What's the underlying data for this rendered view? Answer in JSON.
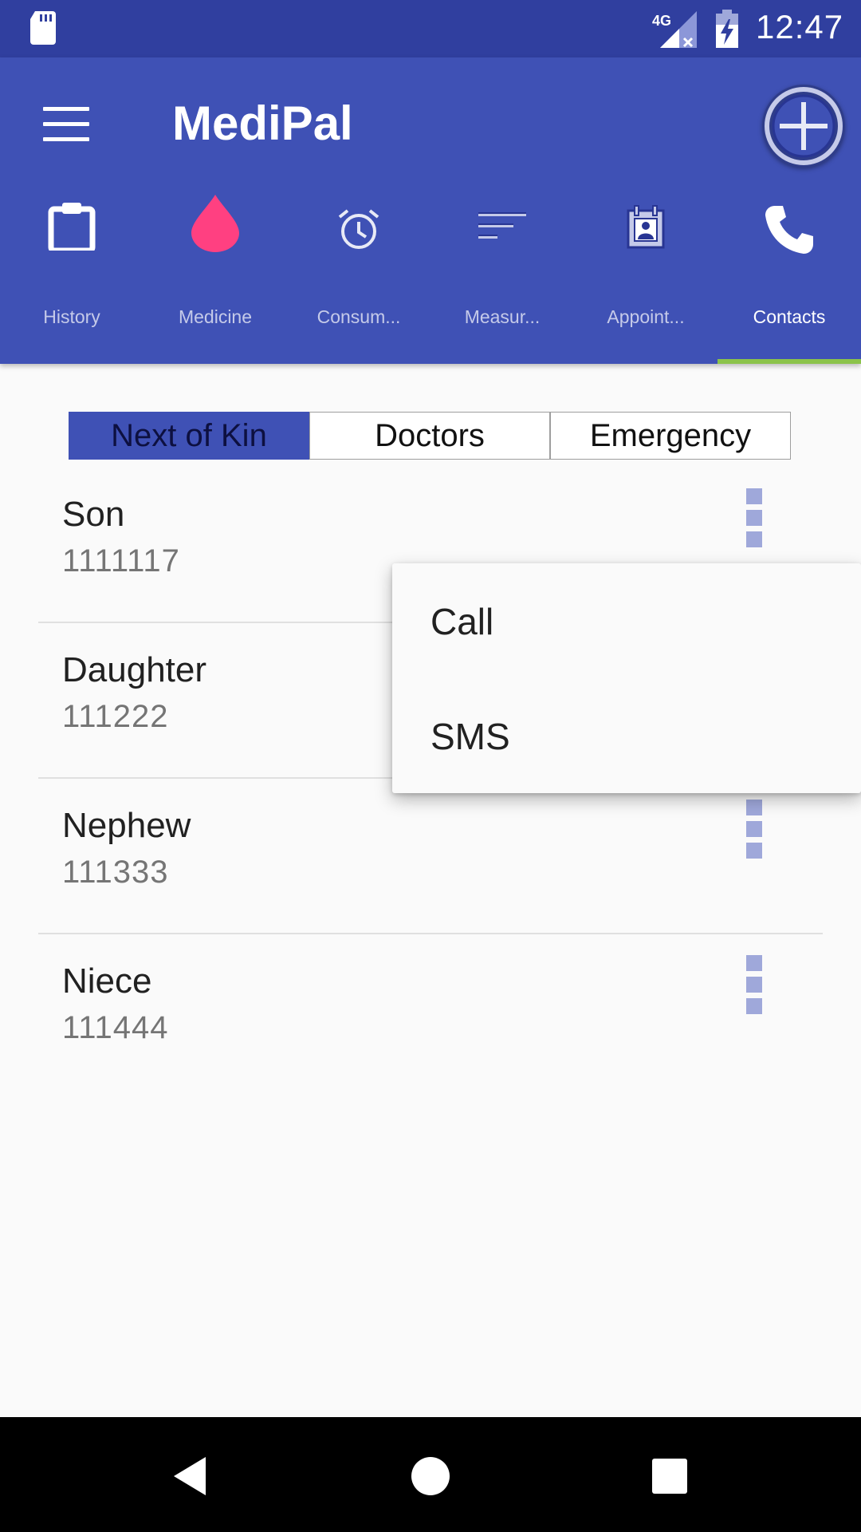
{
  "status_bar": {
    "time": "12:47",
    "network_label": "4G",
    "icons": [
      "sd-card-icon",
      "signal-icon",
      "battery-charging-icon"
    ]
  },
  "app_bar": {
    "title": "MediPal",
    "menu_icon": "hamburger-menu-icon",
    "add_icon": "add-circle-icon",
    "colors": {
      "primary": "#3f51b5",
      "primary_dark": "#303f9f",
      "accent_pink": "#ff4081",
      "indicator": "#8bc34a"
    }
  },
  "tabs": [
    {
      "label": "History",
      "icon": "clipboard-icon"
    },
    {
      "label": "Medicine",
      "icon": "drop-icon"
    },
    {
      "label": "Consum...",
      "icon": "alarm-clock-icon"
    },
    {
      "label": "Measur...",
      "icon": "sort-lines-icon"
    },
    {
      "label": "Appoint...",
      "icon": "calendar-person-icon"
    },
    {
      "label": "Contacts",
      "icon": "phone-icon",
      "active": true
    }
  ],
  "segments": [
    {
      "label": "Next of Kin",
      "active": true
    },
    {
      "label": "Doctors"
    },
    {
      "label": "Emergency"
    }
  ],
  "contacts": [
    {
      "name": "Son",
      "phone": "1111117"
    },
    {
      "name": "Daughter",
      "phone": "111222"
    },
    {
      "name": "Nephew",
      "phone": "111333"
    },
    {
      "name": "Niece",
      "phone": "111444"
    }
  ],
  "popup_menu": {
    "items": [
      "Call",
      "SMS"
    ]
  },
  "nav_bar": {
    "icons": [
      "back-icon",
      "home-icon",
      "recents-icon"
    ]
  }
}
